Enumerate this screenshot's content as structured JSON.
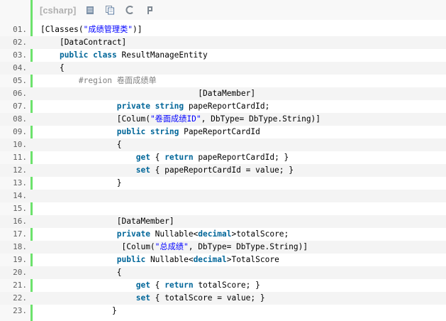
{
  "toolbar": {
    "language_label": "[csharp]",
    "icons": [
      "view-source-icon",
      "copy-icon",
      "refresh-icon",
      "fork-icon"
    ]
  },
  "colors": {
    "keyword": "#006699",
    "string": "#0000ff",
    "preprocessor": "#808080",
    "gutter_rule": "#6ce26c"
  },
  "lines": [
    {
      "n": "01.",
      "indent": "",
      "tokens": [
        {
          "t": "[Classes("
        },
        {
          "t": "\"成绩管理类\"",
          "c": "str"
        },
        {
          "t": ")]"
        }
      ]
    },
    {
      "n": "02.",
      "indent": "    ",
      "tokens": [
        {
          "t": "[DataContract]"
        }
      ]
    },
    {
      "n": "03.",
      "indent": "    ",
      "tokens": [
        {
          "t": "public class",
          "c": "kw"
        },
        {
          "t": " ResultManageEntity"
        }
      ]
    },
    {
      "n": "04.",
      "indent": "    ",
      "tokens": [
        {
          "t": "{"
        }
      ]
    },
    {
      "n": "05.",
      "indent": "        ",
      "tokens": [
        {
          "t": "#region 卷面成绩单",
          "c": "pre"
        }
      ]
    },
    {
      "n": "06.",
      "indent": "                                 ",
      "tokens": [
        {
          "t": "[DataMember]"
        }
      ]
    },
    {
      "n": "07.",
      "indent": "                ",
      "tokens": [
        {
          "t": "private string",
          "c": "kw"
        },
        {
          "t": " papeReportCardId;"
        }
      ]
    },
    {
      "n": "08.",
      "indent": "                ",
      "tokens": [
        {
          "t": "[Colum("
        },
        {
          "t": "\"卷面成绩ID\"",
          "c": "str"
        },
        {
          "t": ", DbType= DbType.String)]"
        }
      ]
    },
    {
      "n": "09.",
      "indent": "                ",
      "tokens": [
        {
          "t": "public string",
          "c": "kw"
        },
        {
          "t": " PapeReportCardId"
        }
      ]
    },
    {
      "n": "10.",
      "indent": "                ",
      "tokens": [
        {
          "t": "{"
        }
      ]
    },
    {
      "n": "11.",
      "indent": "                    ",
      "tokens": [
        {
          "t": "get",
          "c": "kw"
        },
        {
          "t": " { "
        },
        {
          "t": "return",
          "c": "kw"
        },
        {
          "t": " papeReportCardId; }"
        }
      ]
    },
    {
      "n": "12.",
      "indent": "                    ",
      "tokens": [
        {
          "t": "set",
          "c": "kw"
        },
        {
          "t": " { papeReportCardId = value; }"
        }
      ]
    },
    {
      "n": "13.",
      "indent": "                ",
      "tokens": [
        {
          "t": "}"
        }
      ]
    },
    {
      "n": "14.",
      "indent": "",
      "tokens": []
    },
    {
      "n": "15.",
      "indent": "",
      "tokens": []
    },
    {
      "n": "16.",
      "indent": "                ",
      "tokens": [
        {
          "t": "[DataMember]"
        }
      ]
    },
    {
      "n": "17.",
      "indent": "                ",
      "tokens": [
        {
          "t": "private",
          "c": "kw"
        },
        {
          "t": " Nullable<"
        },
        {
          "t": "decimal",
          "c": "kw"
        },
        {
          "t": ">totalScore;"
        }
      ]
    },
    {
      "n": "18.",
      "indent": "                 ",
      "tokens": [
        {
          "t": "[Colum("
        },
        {
          "t": "\"总成绩\"",
          "c": "str"
        },
        {
          "t": ", DbType= DbType.String)]"
        }
      ]
    },
    {
      "n": "19.",
      "indent": "                ",
      "tokens": [
        {
          "t": "public",
          "c": "kw"
        },
        {
          "t": " Nullable<"
        },
        {
          "t": "decimal",
          "c": "kw"
        },
        {
          "t": ">TotalScore"
        }
      ]
    },
    {
      "n": "20.",
      "indent": "                ",
      "tokens": [
        {
          "t": "{"
        }
      ]
    },
    {
      "n": "21.",
      "indent": "                    ",
      "tokens": [
        {
          "t": "get",
          "c": "kw"
        },
        {
          "t": " { "
        },
        {
          "t": "return",
          "c": "kw"
        },
        {
          "t": " totalScore; }"
        }
      ]
    },
    {
      "n": "22.",
      "indent": "                    ",
      "tokens": [
        {
          "t": "set",
          "c": "kw"
        },
        {
          "t": " { totalScore = value; }"
        }
      ]
    },
    {
      "n": "23.",
      "indent": "               ",
      "tokens": [
        {
          "t": "}"
        }
      ]
    }
  ]
}
